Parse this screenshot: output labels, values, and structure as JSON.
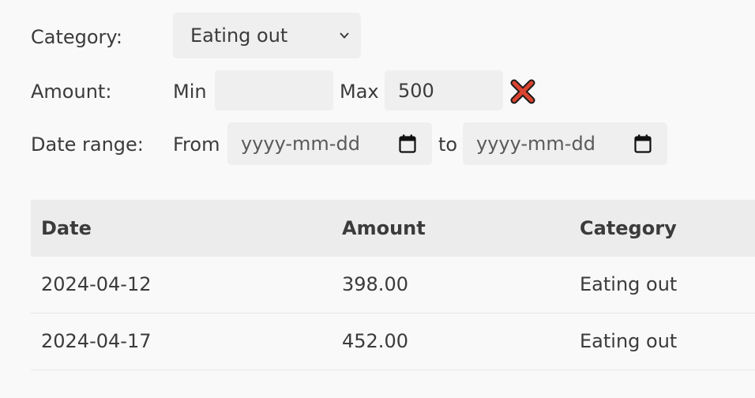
{
  "filters": {
    "category": {
      "label": "Category:",
      "selected": "Eating out"
    },
    "amount": {
      "label": "Amount:",
      "min_label": "Min",
      "min_value": "",
      "max_label": "Max",
      "max_value": "500",
      "clear_icon": "close-icon",
      "clear_color": "#d9432f"
    },
    "date_range": {
      "label": "Date range:",
      "from_label": "From",
      "from_placeholder": "yyyy-mm-dd",
      "to_label": "to",
      "to_placeholder": "yyyy-mm-dd",
      "calendar_icon": "calendar-icon"
    }
  },
  "table": {
    "headers": [
      "Date",
      "Amount",
      "Category"
    ],
    "rows": [
      [
        "2024-04-12",
        "398.00",
        "Eating out"
      ],
      [
        "2024-04-17",
        "452.00",
        "Eating out"
      ]
    ]
  }
}
